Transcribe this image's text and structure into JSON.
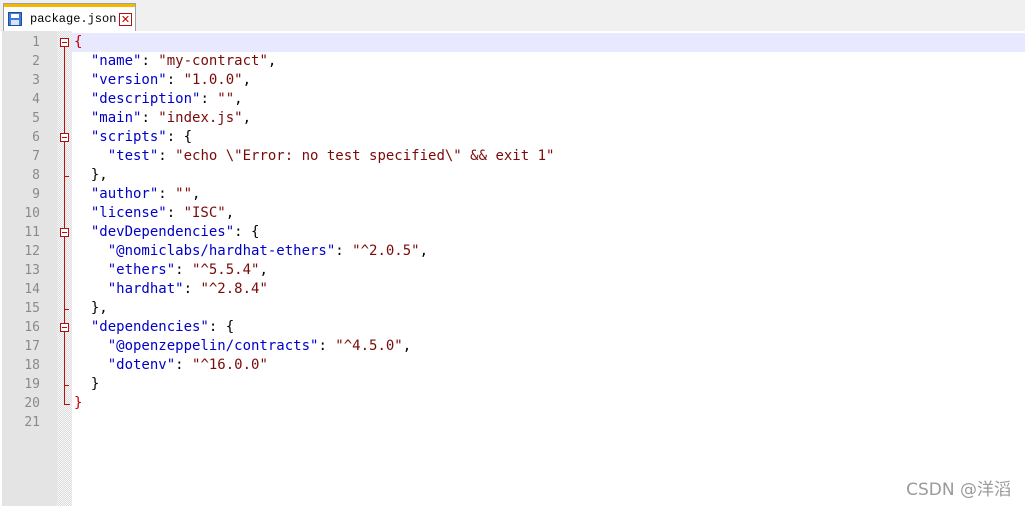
{
  "tab": {
    "title": "package.json",
    "icon": "save-icon",
    "close_icon": "close-icon"
  },
  "lines": [
    [
      {
        "t": "{",
        "c": "b"
      }
    ],
    [
      {
        "t": "  ",
        "c": "p"
      },
      {
        "t": "\"name\"",
        "c": "k"
      },
      {
        "t": ": ",
        "c": "p"
      },
      {
        "t": "\"my-contract\"",
        "c": "s"
      },
      {
        "t": ",",
        "c": "p"
      }
    ],
    [
      {
        "t": "  ",
        "c": "p"
      },
      {
        "t": "\"version\"",
        "c": "k"
      },
      {
        "t": ": ",
        "c": "p"
      },
      {
        "t": "\"1.0.0\"",
        "c": "s"
      },
      {
        "t": ",",
        "c": "p"
      }
    ],
    [
      {
        "t": "  ",
        "c": "p"
      },
      {
        "t": "\"description\"",
        "c": "k"
      },
      {
        "t": ": ",
        "c": "p"
      },
      {
        "t": "\"\"",
        "c": "s"
      },
      {
        "t": ",",
        "c": "p"
      }
    ],
    [
      {
        "t": "  ",
        "c": "p"
      },
      {
        "t": "\"main\"",
        "c": "k"
      },
      {
        "t": ": ",
        "c": "p"
      },
      {
        "t": "\"index.js\"",
        "c": "s"
      },
      {
        "t": ",",
        "c": "p"
      }
    ],
    [
      {
        "t": "  ",
        "c": "p"
      },
      {
        "t": "\"scripts\"",
        "c": "k"
      },
      {
        "t": ": {",
        "c": "p"
      }
    ],
    [
      {
        "t": "    ",
        "c": "p"
      },
      {
        "t": "\"test\"",
        "c": "k"
      },
      {
        "t": ": ",
        "c": "p"
      },
      {
        "t": "\"echo \\\"Error: no test specified\\\" && exit 1\"",
        "c": "s"
      }
    ],
    [
      {
        "t": "  },",
        "c": "p"
      }
    ],
    [
      {
        "t": "  ",
        "c": "p"
      },
      {
        "t": "\"author\"",
        "c": "k"
      },
      {
        "t": ": ",
        "c": "p"
      },
      {
        "t": "\"\"",
        "c": "s"
      },
      {
        "t": ",",
        "c": "p"
      }
    ],
    [
      {
        "t": "  ",
        "c": "p"
      },
      {
        "t": "\"license\"",
        "c": "k"
      },
      {
        "t": ": ",
        "c": "p"
      },
      {
        "t": "\"ISC\"",
        "c": "s"
      },
      {
        "t": ",",
        "c": "p"
      }
    ],
    [
      {
        "t": "  ",
        "c": "p"
      },
      {
        "t": "\"devDependencies\"",
        "c": "k"
      },
      {
        "t": ": {",
        "c": "p"
      }
    ],
    [
      {
        "t": "    ",
        "c": "p"
      },
      {
        "t": "\"@nomiclabs/hardhat-ethers\"",
        "c": "k"
      },
      {
        "t": ": ",
        "c": "p"
      },
      {
        "t": "\"^2.0.5\"",
        "c": "s"
      },
      {
        "t": ",",
        "c": "p"
      }
    ],
    [
      {
        "t": "    ",
        "c": "p"
      },
      {
        "t": "\"ethers\"",
        "c": "k"
      },
      {
        "t": ": ",
        "c": "p"
      },
      {
        "t": "\"^5.5.4\"",
        "c": "s"
      },
      {
        "t": ",",
        "c": "p"
      }
    ],
    [
      {
        "t": "    ",
        "c": "p"
      },
      {
        "t": "\"hardhat\"",
        "c": "k"
      },
      {
        "t": ": ",
        "c": "p"
      },
      {
        "t": "\"^2.8.4\"",
        "c": "s"
      }
    ],
    [
      {
        "t": "  },",
        "c": "p"
      }
    ],
    [
      {
        "t": "  ",
        "c": "p"
      },
      {
        "t": "\"dependencies\"",
        "c": "k"
      },
      {
        "t": ": {",
        "c": "p"
      }
    ],
    [
      {
        "t": "    ",
        "c": "p"
      },
      {
        "t": "\"@openzeppelin/contracts\"",
        "c": "k"
      },
      {
        "t": ": ",
        "c": "p"
      },
      {
        "t": "\"^4.5.0\"",
        "c": "s"
      },
      {
        "t": ",",
        "c": "p"
      }
    ],
    [
      {
        "t": "    ",
        "c": "p"
      },
      {
        "t": "\"dotenv\"",
        "c": "k"
      },
      {
        "t": ": ",
        "c": "p"
      },
      {
        "t": "\"^16.0.0\"",
        "c": "s"
      }
    ],
    [
      {
        "t": "  }",
        "c": "p"
      }
    ],
    [
      {
        "t": "}",
        "c": "b"
      }
    ],
    []
  ],
  "fold_starts": [
    1,
    6,
    11,
    16
  ],
  "watermark": "CSDN @洋滔",
  "colors": {
    "key": "#0000c8",
    "string": "#7a0a0a",
    "brace": "#c00000",
    "fold": "#b01010",
    "current_line": "#e8e8ff"
  }
}
